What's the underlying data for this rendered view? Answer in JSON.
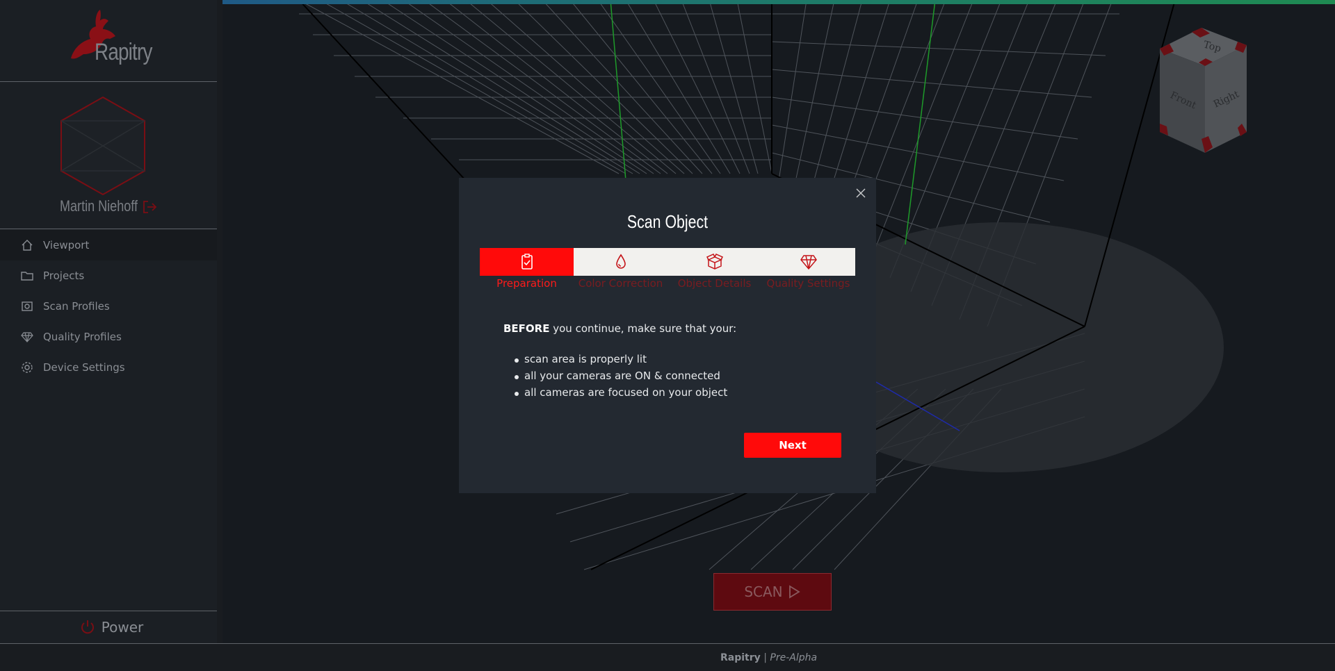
{
  "app": {
    "name": "Rapitry"
  },
  "user": {
    "name": "Martin Niehoff"
  },
  "nav": {
    "items": [
      {
        "label": "Viewport",
        "icon": "home-icon",
        "color": "#1f5a86"
      },
      {
        "label": "Projects",
        "icon": "folder-icon",
        "color": "#1e7a6a"
      },
      {
        "label": "Scan Profiles",
        "icon": "camera-icon",
        "color": "#1f8a52"
      },
      {
        "label": "Quality Profiles",
        "icon": "diamond-icon",
        "color": "#7a8a1e"
      },
      {
        "label": "Device Settings",
        "icon": "gear-icon",
        "color": "#8a1e22"
      }
    ]
  },
  "power": {
    "label": "Power"
  },
  "footer": {
    "brand": "Rapitry",
    "separator": "|",
    "stage": "Pre-Alpha"
  },
  "viewport": {
    "scan_label": "SCAN",
    "cube_faces": {
      "top": "Top",
      "front": "Front",
      "right": "Right"
    }
  },
  "modal": {
    "title": "Scan Object",
    "steps": [
      {
        "label": "Preparation",
        "icon": "clipboard-check-icon",
        "active": true
      },
      {
        "label": "Color Correction",
        "icon": "droplet-icon",
        "active": false
      },
      {
        "label": "Object Details",
        "icon": "box-icon",
        "active": false
      },
      {
        "label": "Quality Settings",
        "icon": "diamond-icon",
        "active": false
      }
    ],
    "intro_bold": "BEFORE",
    "intro_rest": " you continue, make sure that your:",
    "checklist": [
      "scan area is properly lit",
      "all your cameras are ON & connected",
      "all cameras are focused on your object"
    ],
    "next_label": "Next"
  },
  "colors": {
    "accent": "#ff0a0a",
    "modal_bg": "#232931",
    "sidebar_bg": "#1b1f24"
  }
}
